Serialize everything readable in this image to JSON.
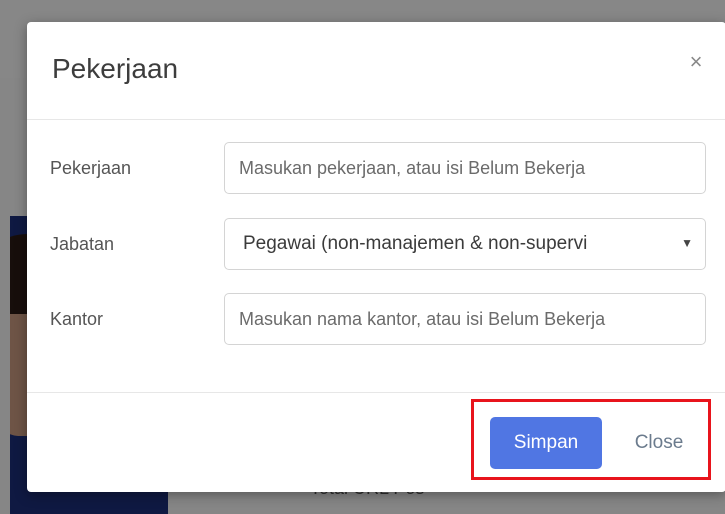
{
  "background": {
    "partial_text": "Total URL Pos"
  },
  "modal": {
    "title": "Pekerjaan",
    "close_icon": "×",
    "fields": {
      "pekerjaan": {
        "label": "Pekerjaan",
        "placeholder": "Masukan pekerjaan, atau isi Belum Bekerja",
        "value": ""
      },
      "jabatan": {
        "label": "Jabatan",
        "selected": "Pegawai (non-manajemen & non-supervi",
        "caret": "▼"
      },
      "kantor": {
        "label": "Kantor",
        "placeholder": "Masukan nama kantor, atau isi Belum Bekerja",
        "value": ""
      }
    },
    "footer": {
      "save_label": "Simpan",
      "close_label": "Close"
    }
  },
  "colors": {
    "primary": "#5076e3",
    "highlight": "#e8141c",
    "link": "#6b7b8d"
  }
}
